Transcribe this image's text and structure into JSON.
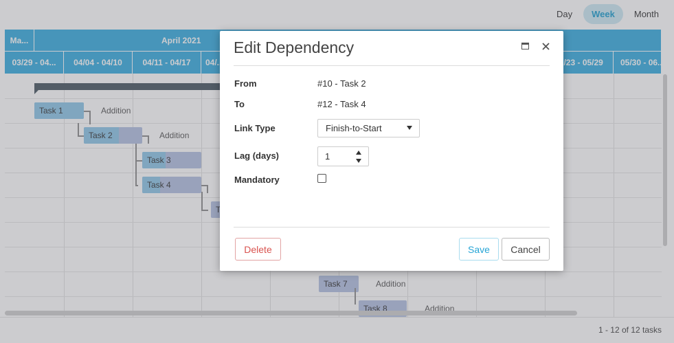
{
  "views": [
    "Day",
    "Week",
    "Month"
  ],
  "active_view": "Week",
  "gantt": {
    "month_headers": [
      "Ma...",
      "April 2021"
    ],
    "week_headers": [
      "03/29 - 04...",
      "04/04 - 04/10",
      "04/11 - 04/17",
      "04/...",
      "",
      "",
      "",
      "",
      "05/23 - 05/29",
      "05/30 - 06..."
    ],
    "tasks": [
      {
        "name": "Task 1",
        "resource": "Addition",
        "progress": 1.0
      },
      {
        "name": "Task 2",
        "resource": "Addition",
        "progress": 0.6
      },
      {
        "name": "Task 3",
        "resource": "",
        "progress": 0.4
      },
      {
        "name": "Task 4",
        "resource": "",
        "progress": 0.3
      },
      {
        "name": "T",
        "resource": "",
        "progress": 0.0
      },
      {
        "name": "Task 7",
        "resource": "Addition",
        "progress": 0.0
      },
      {
        "name": "Task 8",
        "resource": "Addition",
        "progress": 0.0
      }
    ],
    "pager_info": "1 - 12 of 12 tasks"
  },
  "dialog": {
    "title": "Edit Dependency",
    "from_label": "From",
    "from_value": "#10 - Task 2",
    "to_label": "To",
    "to_value": "#12 - Task 4",
    "link_type_label": "Link Type",
    "link_type_value": "Finish-to-Start",
    "lag_label": "Lag (days)",
    "lag_value": "1",
    "mandatory_label": "Mandatory",
    "mandatory_checked": false,
    "delete_label": "Delete",
    "save_label": "Save",
    "cancel_label": "Cancel"
  }
}
